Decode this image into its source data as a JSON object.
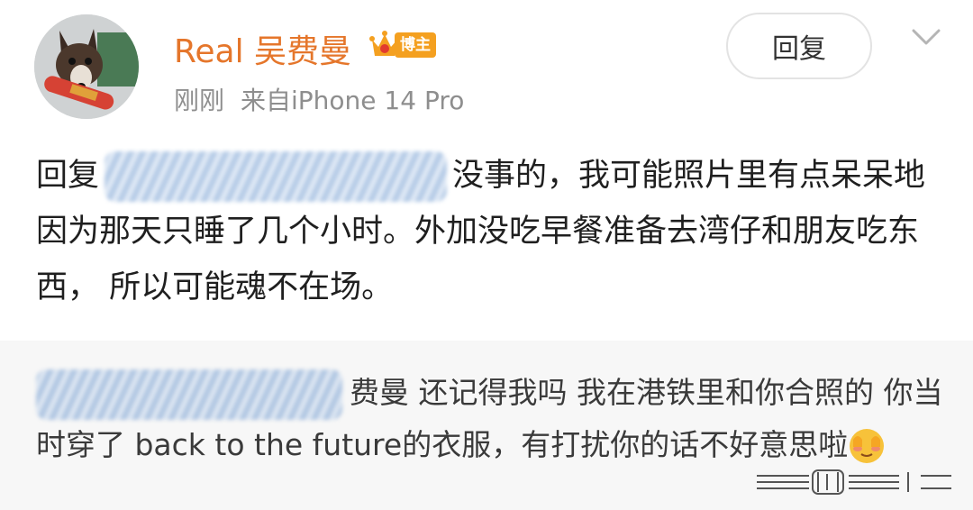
{
  "author": {
    "name": "Real 吴费曼",
    "badge_label": "博主",
    "avatar_icon": "dog-avatar",
    "badge_icon": "crown-icon"
  },
  "meta": {
    "time": "刚刚",
    "source": "来自iPhone 14 Pro"
  },
  "actions": {
    "reply_label": "回复",
    "more_icon": "chevron-down-icon"
  },
  "comment": {
    "prefix": "回复",
    "body": "没事的，我可能照片里有点呆呆地因为那天只睡了几个小时。外加没吃早餐准备去湾仔和朋友吃东西， 所以可能魂不在场。"
  },
  "quoted": {
    "body": "费曼 还记得我吗 我在港铁里和你合照的 你当时穿了 back to the future的衣服，有打扰你的话不好意思啦",
    "emoji_icon": "shy-face-emoji"
  },
  "colors": {
    "name": "#e5762b",
    "meta": "#8e8e8e",
    "badge": "#f4a020",
    "quoted_bg": "#f7f7f7"
  }
}
